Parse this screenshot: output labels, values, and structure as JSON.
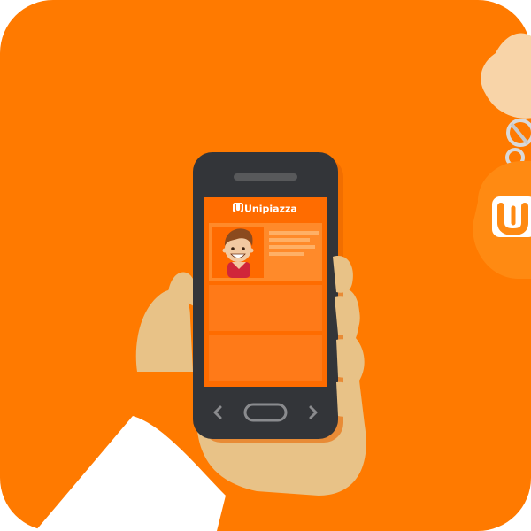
{
  "app": {
    "brand_text": "Unipiazza",
    "keychain_logo": "u-logo-mark"
  },
  "colors": {
    "background": "#FF7A00",
    "phone_body": "#333539",
    "phone_screen_border": "#2a2b2e",
    "screen_bg": "#FF6C00",
    "card_bg": "#FF8A2A",
    "card_alt": "#FF7510",
    "hand": "#E8C287",
    "sleeve": "#FFFFFF",
    "keychain": "#FF8A12",
    "keychain_finger": "#F8D4A8"
  },
  "icons": {
    "nav_left": "chevron-left-icon",
    "nav_right": "chevron-right-icon",
    "home": "home-button-icon",
    "avatar": "avatar-boy-icon"
  }
}
